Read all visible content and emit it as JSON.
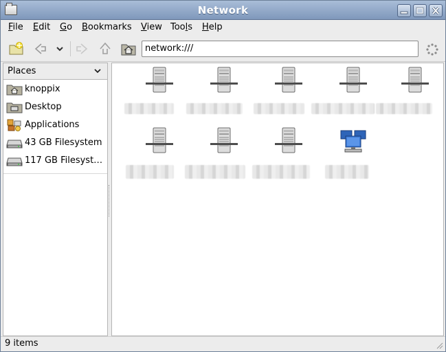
{
  "window": {
    "title": "Network"
  },
  "menubar": [
    {
      "mnemonic": "F",
      "rest": "ile"
    },
    {
      "mnemonic": "E",
      "rest": "dit"
    },
    {
      "mnemonic": "G",
      "rest": "o"
    },
    {
      "mnemonic": "B",
      "rest": "ookmarks"
    },
    {
      "mnemonic": "V",
      "rest": "iew"
    },
    {
      "mnemonic": "T",
      "rest": "ools",
      "prefix": "Too",
      "suffix": "s",
      "mid": "l"
    },
    {
      "mnemonic": "H",
      "rest": "elp"
    }
  ],
  "toolbar": {
    "location": "network:///",
    "icons": [
      "new-folder-bookmark-icon",
      "back-icon",
      "dropdown-chevron-icon",
      "forward-icon",
      "up-icon",
      "home-icon",
      "throbber-icon"
    ]
  },
  "sidebar": {
    "header": "Places",
    "items": [
      {
        "label": "knoppix",
        "icon": "home-folder-icon"
      },
      {
        "label": "Desktop",
        "icon": "desktop-folder-icon"
      },
      {
        "label": "Applications",
        "icon": "applications-icon"
      },
      {
        "label": "43 GB Filesystem",
        "icon": "drive-icon"
      },
      {
        "label": "117 GB Filesyst…",
        "icon": "drive-icon"
      }
    ]
  },
  "network_items": [
    {
      "icon": "server-icon",
      "label": ""
    },
    {
      "icon": "server-icon",
      "label": ""
    },
    {
      "icon": "server-icon",
      "label": ""
    },
    {
      "icon": "server-icon",
      "label": ""
    },
    {
      "icon": "server-icon",
      "label": ""
    },
    {
      "icon": "server-icon",
      "label": ""
    },
    {
      "icon": "server-icon",
      "label": ""
    },
    {
      "icon": "server-icon",
      "label": ""
    },
    {
      "icon": "network-computers-icon",
      "label": ""
    }
  ],
  "status": {
    "text": "9 items"
  },
  "colors": {
    "titlebar": "#8ea6c7",
    "accent": "#5d7394"
  }
}
